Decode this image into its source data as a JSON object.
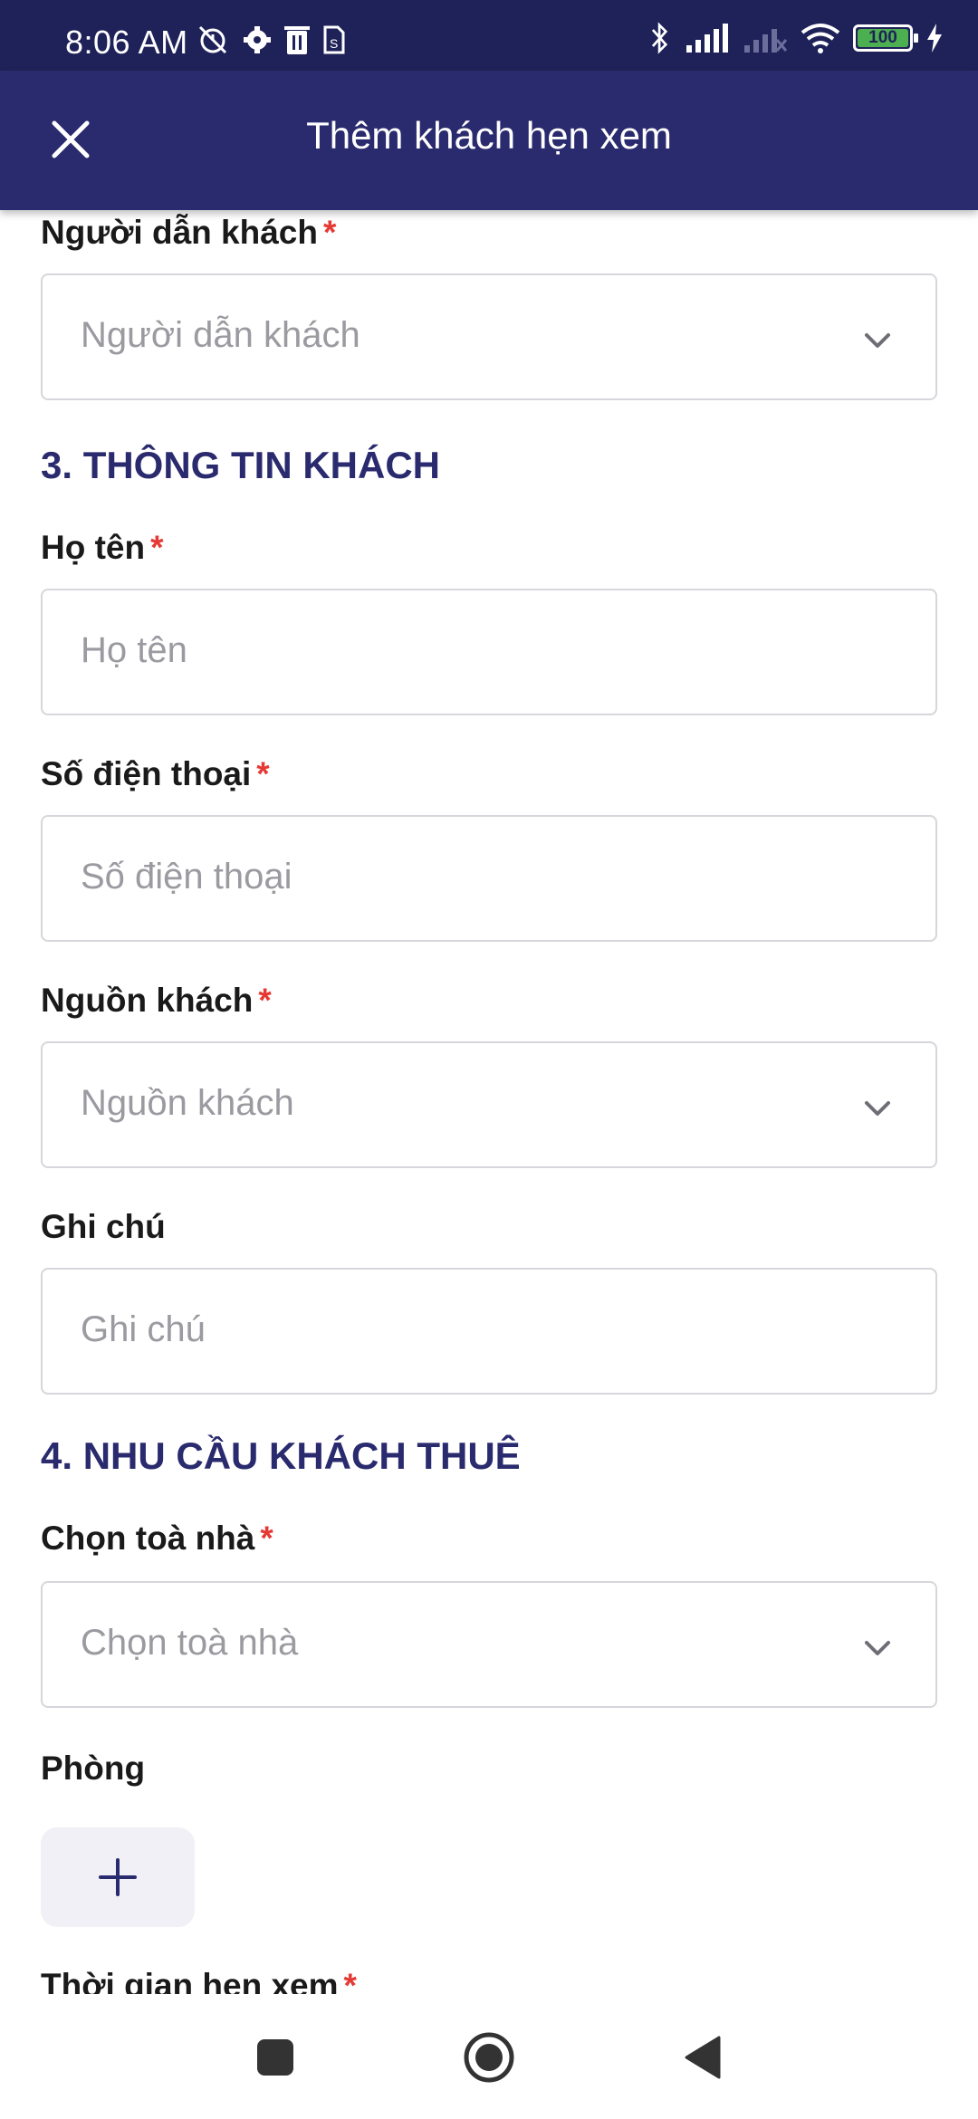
{
  "status_bar": {
    "time": "8:06 AM",
    "battery": "100",
    "icons_left": [
      "alarm-off-icon",
      "settings-icon",
      "trash-icon",
      "sim-icon"
    ],
    "icons_right": [
      "bluetooth-icon",
      "signal-icon",
      "signal-off-icon",
      "wifi-icon",
      "battery-icon",
      "charging-icon"
    ]
  },
  "app_bar": {
    "title": "Thêm khách hẹn xem"
  },
  "form": {
    "guide": {
      "label": "Người dẫn khách",
      "required": "*",
      "placeholder": "Người dẫn khách"
    },
    "section3": "3. THÔNG TIN KHÁCH",
    "name": {
      "label": "Họ tên",
      "required": "*",
      "placeholder": "Họ tên"
    },
    "phone": {
      "label": "Số điện thoại",
      "required": "*",
      "placeholder": "Số điện thoại"
    },
    "source": {
      "label": "Nguồn khách",
      "required": "*",
      "placeholder": "Nguồn khách"
    },
    "note": {
      "label": "Ghi chú",
      "placeholder": "Ghi chú"
    },
    "section4": "4. NHU CẦU KHÁCH THUÊ",
    "building": {
      "label": "Chọn toà nhà",
      "required": "*",
      "placeholder": "Chọn toà nhà"
    },
    "room": {
      "label": "Phòng"
    },
    "viewing_time": {
      "label": "Thời gian hẹn xem",
      "required": "*"
    }
  },
  "colors": {
    "primary": "#2a2a6e",
    "status_bar": "#1f2259",
    "required": "#e53935",
    "placeholder": "#9a9aa0",
    "border": "#d6d6dc"
  }
}
